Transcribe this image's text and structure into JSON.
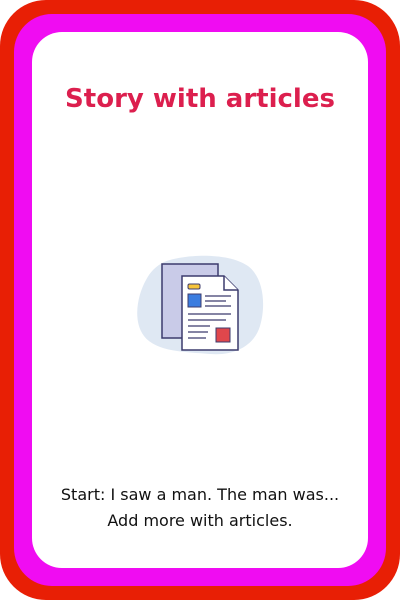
{
  "card": {
    "title": "Story with articles",
    "description": "Start: I saw a man. The man was... Add more with articles.",
    "illustration_icon": "document-icon"
  },
  "colors": {
    "outer_border": "#e81f05",
    "inner_border": "#f00cf2",
    "title": "#dc1f4e",
    "background": "#ffffff"
  }
}
